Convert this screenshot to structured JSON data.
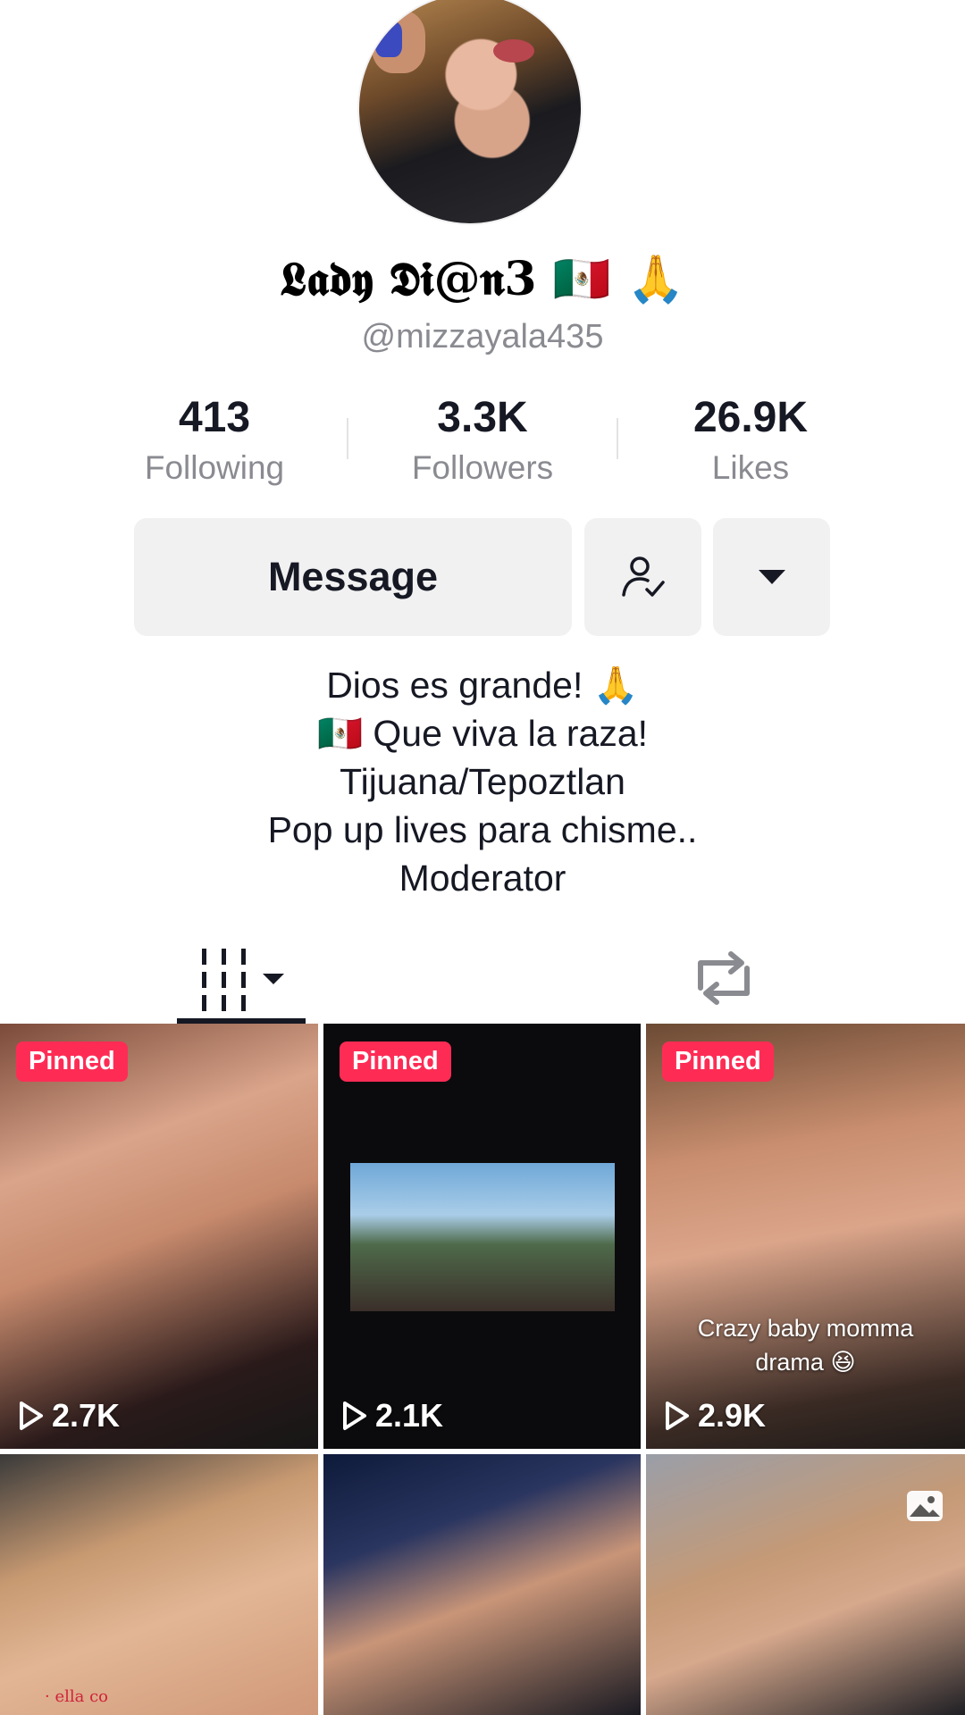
{
  "profile": {
    "display_name": "𝕷𝖆𝖉𝖞 𝕯𝖎@𝖓3 🇲🇽 🙏",
    "username": "@mizzayala435"
  },
  "stats": [
    {
      "value": "413",
      "label": "Following"
    },
    {
      "value": "3.3K",
      "label": "Followers"
    },
    {
      "value": "26.9K",
      "label": "Likes"
    }
  ],
  "actions": {
    "message_label": "Message",
    "follow_icon": "user-check-icon",
    "more_icon": "caret-down-icon"
  },
  "bio": [
    "Dios es grande! 🙏",
    "🇲🇽 Que viva la raza!",
    "Tijuana/Tepoztlan",
    "Pop up lives para chisme..",
    "Moderator"
  ],
  "tabs": {
    "grid_icon": "video-grid-icon",
    "repost_icon": "repost-icon"
  },
  "videos": [
    {
      "pinned": "Pinned",
      "views": "2.7K"
    },
    {
      "pinned": "Pinned",
      "views": "2.1K"
    },
    {
      "pinned": "Pinned",
      "views": "2.9K",
      "caption_line1": "Crazy baby momma",
      "caption_line2": "drama 😆"
    },
    {},
    {},
    {
      "icon": "photo-icon"
    }
  ],
  "colors": {
    "accent": "#fe2c55",
    "button_bg": "#f1f1f2",
    "secondary_text": "#8a8b91"
  }
}
